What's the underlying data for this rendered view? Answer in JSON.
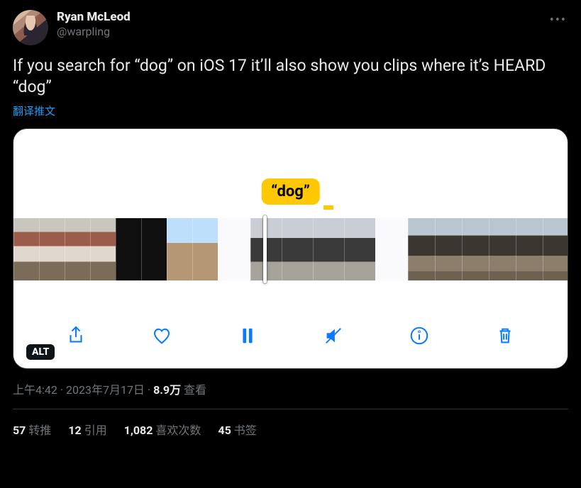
{
  "author": {
    "display_name": "Ryan McLeod",
    "handle": "@warpling"
  },
  "tweet_text": "If you search for “dog” on iOS 17 it’ll also show you clips where it’s HEARD “dog”",
  "translate_label": "翻译推文",
  "media": {
    "bubble_text": "“dog”",
    "alt_badge": "ALT",
    "toolbar_icons": {
      "share": "share-icon",
      "like": "heart-icon",
      "pause": "pause-icon",
      "mute": "speaker-mute-icon",
      "info": "info-icon",
      "trash": "trash-icon"
    }
  },
  "meta": {
    "time": "上午4:42",
    "date": "2023年7月17日",
    "views_value": "8.9万",
    "views_label": "查看",
    "separator": " · "
  },
  "stats": {
    "retweets": {
      "count": "57",
      "label": "转推"
    },
    "quotes": {
      "count": "12",
      "label": "引用"
    },
    "likes": {
      "count": "1,082",
      "label": "喜欢次数"
    },
    "bookmarks": {
      "count": "45",
      "label": "书签"
    }
  }
}
